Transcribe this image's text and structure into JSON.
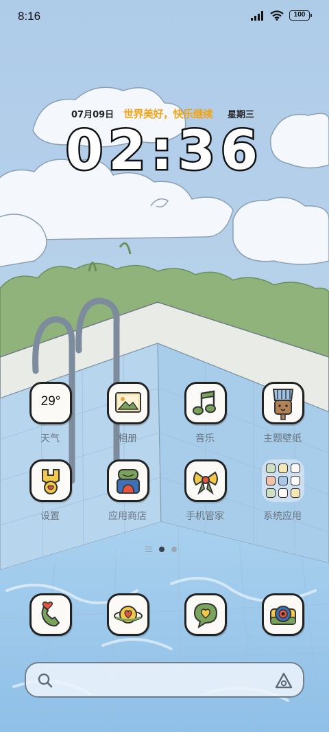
{
  "status_bar": {
    "time": "8:16",
    "battery": "100",
    "icons": [
      "signal-icon",
      "wifi-icon",
      "battery-icon"
    ]
  },
  "clock_widget": {
    "date": "07月09日",
    "motto": "世界美好，快乐继续",
    "weekday": "星期三",
    "time": "02:36"
  },
  "apps": [
    {
      "label": "天气",
      "icon": "weather-icon",
      "temp": "29°"
    },
    {
      "label": "相册",
      "icon": "gallery-icon"
    },
    {
      "label": "音乐",
      "icon": "music-icon"
    },
    {
      "label": "主题壁纸",
      "icon": "themes-brush-icon"
    },
    {
      "label": "设置",
      "icon": "settings-icon"
    },
    {
      "label": "应用商店",
      "icon": "app-store-bag-icon"
    },
    {
      "label": "手机管家",
      "icon": "phone-manager-bow-icon"
    },
    {
      "label": "系统应用",
      "icon": "folder-icon"
    }
  ],
  "dock": [
    {
      "icon": "phone-icon"
    },
    {
      "icon": "messages-icon"
    },
    {
      "icon": "chat-heart-icon"
    },
    {
      "icon": "camera-icon"
    }
  ],
  "page_indicator": {
    "pages": 2,
    "active": 1
  },
  "search_bar": {
    "icons": [
      "search-icon",
      "ai-assistant-icon"
    ]
  },
  "colors": {
    "sky": "#b9d3ea",
    "motto": "#f2a316",
    "clock_fill": "#ffffff",
    "clock_outline": "#111111",
    "label": "#6a7480",
    "pool_water": "#9cc7ea",
    "bush": "#8fb37a"
  }
}
